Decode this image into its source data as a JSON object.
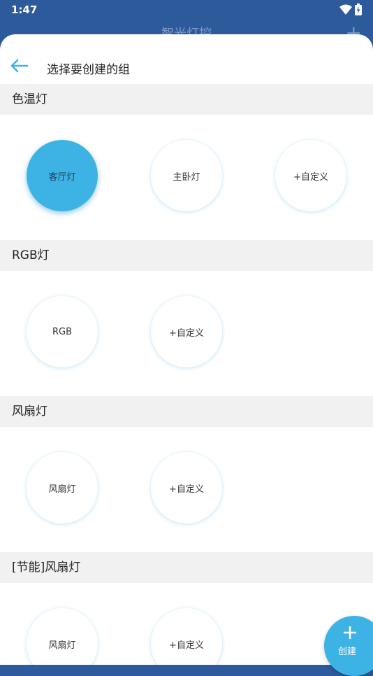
{
  "status_bar": {
    "time": "1:47"
  },
  "background": {
    "title": "智光灯控",
    "plus_icon": "plus-icon"
  },
  "sheet": {
    "title": "选择要创建的组",
    "back_icon": "back-arrow-icon"
  },
  "sections": [
    {
      "title": "色温灯",
      "items": [
        {
          "label": "客厅灯",
          "selected": true
        },
        {
          "label": "主卧灯"
        },
        {
          "label": "+自定义"
        }
      ]
    },
    {
      "title": "RGB灯",
      "items": [
        {
          "label": "RGB"
        },
        {
          "label": "+自定义"
        }
      ]
    },
    {
      "title": "风扇灯",
      "items": [
        {
          "label": "风扇灯"
        },
        {
          "label": "+自定义"
        }
      ]
    },
    {
      "title": "[节能]风扇灯",
      "items": [
        {
          "label": "风扇灯"
        },
        {
          "label": "+自定义"
        }
      ]
    }
  ],
  "fab": {
    "label": "创建",
    "icon": "plus-icon"
  },
  "colors": {
    "header": "#2d5a9b",
    "accent": "#3db2e5",
    "section_bg": "#f1f1f1"
  }
}
